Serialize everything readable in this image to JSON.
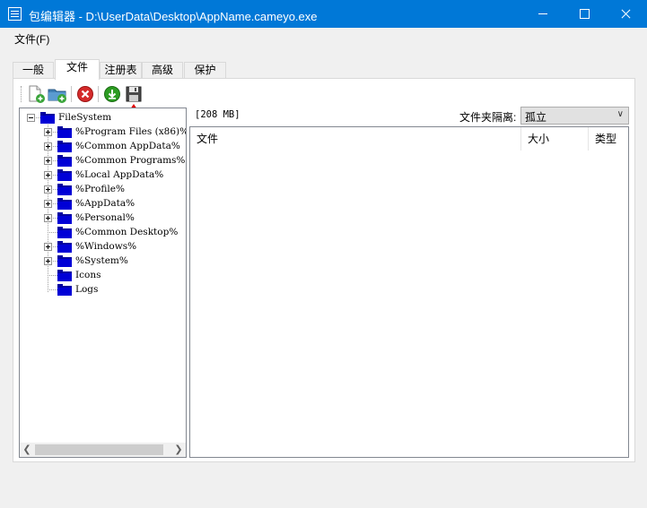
{
  "window": {
    "title": "包编辑器 - D:\\UserData\\Desktop\\AppName.cameyo.exe"
  },
  "menu": {
    "file": "文件(F)"
  },
  "tabs": [
    {
      "label": "一般"
    },
    {
      "label": "文件",
      "active": true
    },
    {
      "label": "注册表"
    },
    {
      "label": "高级"
    },
    {
      "label": "保护"
    }
  ],
  "toolbar": {
    "buttons": [
      "add-file-icon",
      "add-folder-icon",
      "delete-icon",
      "extract-icon",
      "save-icon"
    ]
  },
  "tree": {
    "root": "FileSystem",
    "items": [
      {
        "label": "%Program Files (x86)%",
        "expandable": true
      },
      {
        "label": "%Common AppData%",
        "expandable": true
      },
      {
        "label": "%Common Programs%",
        "expandable": true
      },
      {
        "label": "%Local AppData%",
        "expandable": true
      },
      {
        "label": "%Profile%",
        "expandable": true
      },
      {
        "label": "%AppData%",
        "expandable": true
      },
      {
        "label": "%Personal%",
        "expandable": true
      },
      {
        "label": "%Common Desktop%",
        "expandable": false
      },
      {
        "label": "%Windows%",
        "expandable": true
      },
      {
        "label": "%System%",
        "expandable": true
      },
      {
        "label": "Icons",
        "expandable": false
      },
      {
        "label": "Logs",
        "expandable": false
      }
    ]
  },
  "details": {
    "size": "[208 MB]",
    "isolation_label": "文件夹隔离:",
    "isolation_value": "孤立",
    "columns": [
      "文件",
      "大小",
      "类型"
    ]
  },
  "colors": {
    "titlebar": "#0078d7",
    "folder": "#0000d6",
    "delete": "#d42a2a",
    "extract": "#2c9c22"
  }
}
